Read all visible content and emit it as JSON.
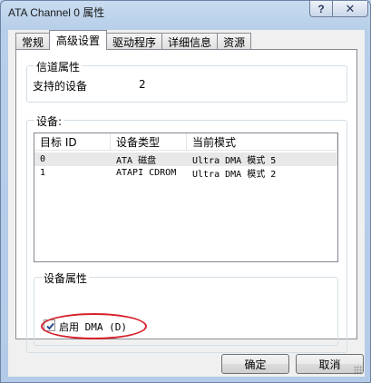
{
  "window": {
    "title": "ATA Channel 0 属性",
    "help_glyph": "?",
    "close_glyph": "✕"
  },
  "tabs": [
    {
      "label": "常规",
      "active": false
    },
    {
      "label": "高级设置",
      "active": true
    },
    {
      "label": "驱动程序",
      "active": false
    },
    {
      "label": "详细信息",
      "active": false
    },
    {
      "label": "资源",
      "active": false
    }
  ],
  "channel_props": {
    "legend": "信道属性",
    "supported_devices_label": "支持的设备",
    "supported_devices_value": "2"
  },
  "devices": {
    "legend": "设备:",
    "columns": [
      "目标 ID",
      "设备类型",
      "当前模式"
    ],
    "rows": [
      [
        "0",
        "ATA 磁盘",
        "Ultra DMA 模式 5"
      ],
      [
        "1",
        "ATAPI CDROM",
        "Ultra DMA 模式 2"
      ]
    ]
  },
  "device_props": {
    "legend": "设备属性",
    "enable_dma_label": "启用 DMA (D)",
    "enable_dma_checked": true
  },
  "buttons": {
    "ok": "确定",
    "cancel": "取消"
  },
  "colors": {
    "highlight_oval": "#d6202a"
  }
}
